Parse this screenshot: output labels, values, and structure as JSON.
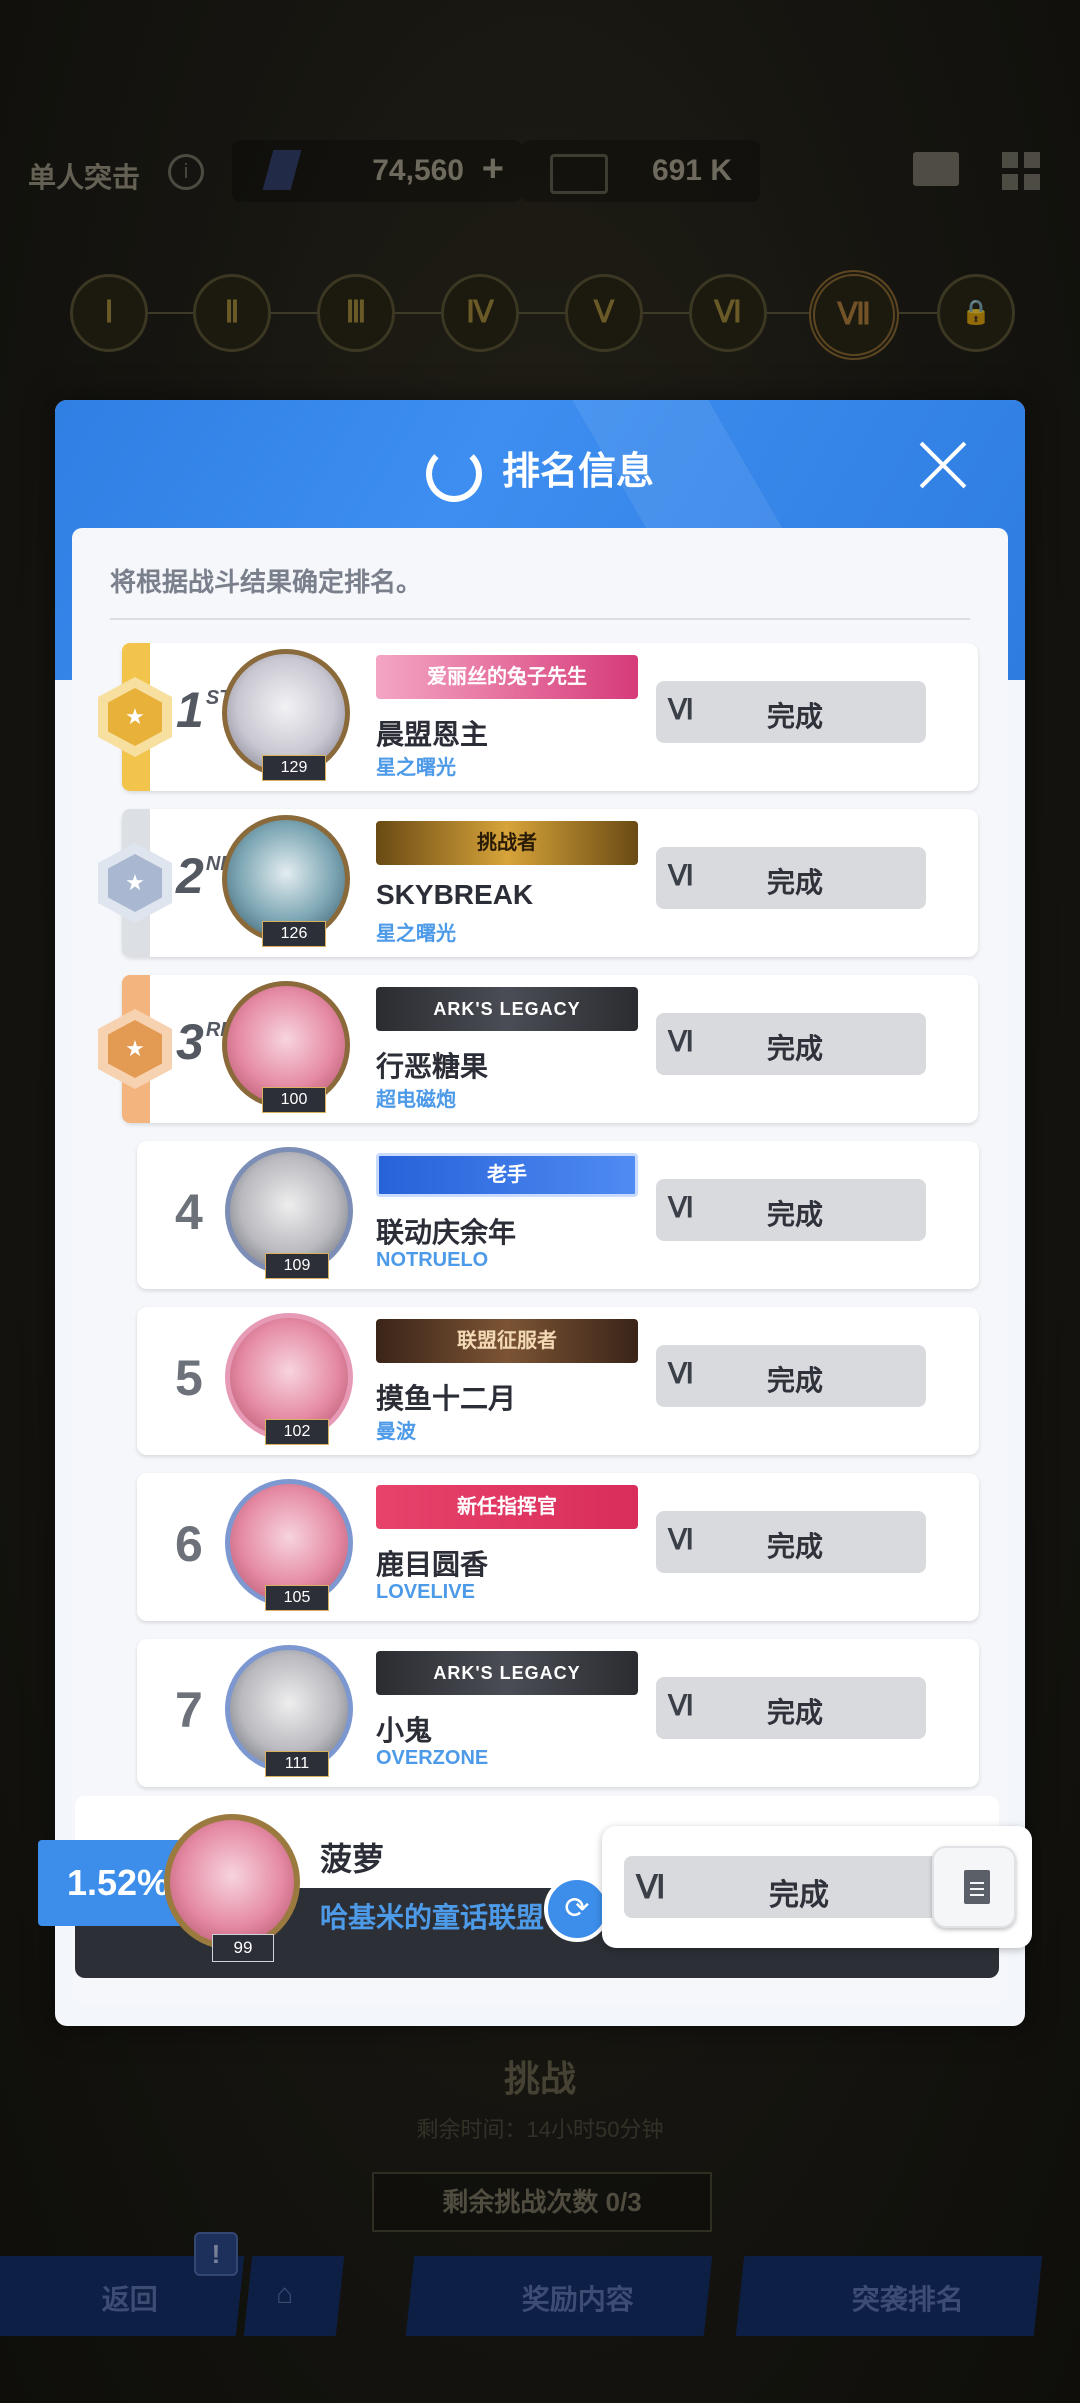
{
  "topbar": {
    "mode_label": "单人突击",
    "currency_1": "74,560",
    "currency_1_plus": "+",
    "currency_2": "691 K"
  },
  "stages": [
    "Ⅰ",
    "Ⅱ",
    "Ⅲ",
    "Ⅳ",
    "Ⅴ",
    "Ⅵ",
    "Ⅶ",
    "🔒"
  ],
  "modal": {
    "title": "排名信息",
    "note": "将根据战斗结果确定排名。"
  },
  "rows": [
    {
      "rank": "1",
      "rank_suffix": "ST",
      "medal_color": "#e8b23a",
      "accent": "#f2c44c",
      "level": "129",
      "title": "爱丽丝的兔子先生",
      "name": "晨盟恩主",
      "guild": "星之曙光",
      "tier": "Ⅵ",
      "status": "完成"
    },
    {
      "rank": "2",
      "rank_suffix": "ND",
      "medal_color": "#a9b8d0",
      "accent": "#dcdfe4",
      "level": "126",
      "title": "挑战者",
      "name": "SKYBREAK",
      "guild": "星之曙光",
      "tier": "Ⅵ",
      "status": "完成"
    },
    {
      "rank": "3",
      "rank_suffix": "RD",
      "medal_color": "#e39a52",
      "accent": "#f3b57d",
      "level": "100",
      "title": "ARK'S LEGACY",
      "name": "行恶糖果",
      "guild": "超电磁炮",
      "tier": "Ⅵ",
      "status": "完成"
    },
    {
      "rank": "4",
      "level": "109",
      "title": "老手",
      "name": "联动庆余年",
      "guild": "NOTRUELO",
      "tier": "Ⅵ",
      "status": "完成"
    },
    {
      "rank": "5",
      "level": "102",
      "title": "联盟征服者",
      "name": "摸鱼十二月",
      "guild": "曼波",
      "tier": "Ⅵ",
      "status": "完成"
    },
    {
      "rank": "6",
      "level": "105",
      "title": "新任指挥官",
      "name": "鹿目圆香",
      "guild": "LOVELIVE",
      "tier": "Ⅵ",
      "status": "完成"
    },
    {
      "rank": "7",
      "level": "111",
      "title": "ARK'S LEGACY",
      "name": "小鬼",
      "guild": "OVERZONE",
      "tier": "Ⅵ",
      "status": "完成"
    }
  ],
  "me": {
    "percent": "1.52%",
    "level": "99",
    "name": "菠萝",
    "guild": "哈基米的童话联盟",
    "tier": "Ⅵ",
    "status": "完成"
  },
  "bottom": {
    "challenge": "挑战",
    "challenge_sub": "剩余时间：14小时50分钟",
    "remaining": "剩余挑战次数  0/3",
    "back": "返回",
    "badge": "!",
    "reward": "奖励内容",
    "ranking": "突袭排名"
  },
  "colors": {
    "modal_header": "#3d8ef0",
    "link_blue": "#4d9ae8",
    "percent_bg": "#3c8eea"
  }
}
